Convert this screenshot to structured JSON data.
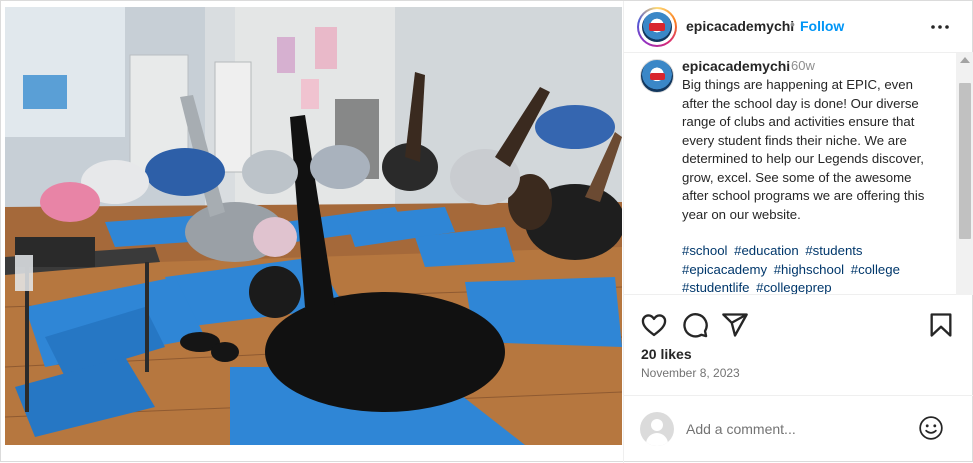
{
  "post": {
    "username": "epicacademychi",
    "follow_label": "Follow",
    "separator": "•",
    "more_icon": "more-horizontal-icon"
  },
  "caption": {
    "username": "epicacademychi",
    "time_ago": "60w",
    "text": "Big things are happening at EPIC, even after the school day is done! Our diverse range of clubs and activities ensure that every student finds their niche. We are determined to help our Legends discover, grow, excel. See some of the awesome after school programs we are offering this year on our website.",
    "hashtags": [
      "#school",
      "#education",
      "#students",
      "#epicacademy",
      "#highschool",
      "#college",
      "#studentlife",
      "#collegeprep"
    ]
  },
  "actions": {
    "icons": [
      "heart-icon",
      "comment-icon",
      "share-icon",
      "bookmark-icon"
    ],
    "likes": "20 likes",
    "date": "November 8, 2023"
  },
  "comment": {
    "placeholder": "Add a comment...",
    "emoji_icon": "emoji-icon"
  },
  "colors": {
    "link_blue": "#0095f6",
    "hashtag_blue": "#00376b",
    "mat_blue": "#2f86d6",
    "border": "#dbdbdb"
  }
}
